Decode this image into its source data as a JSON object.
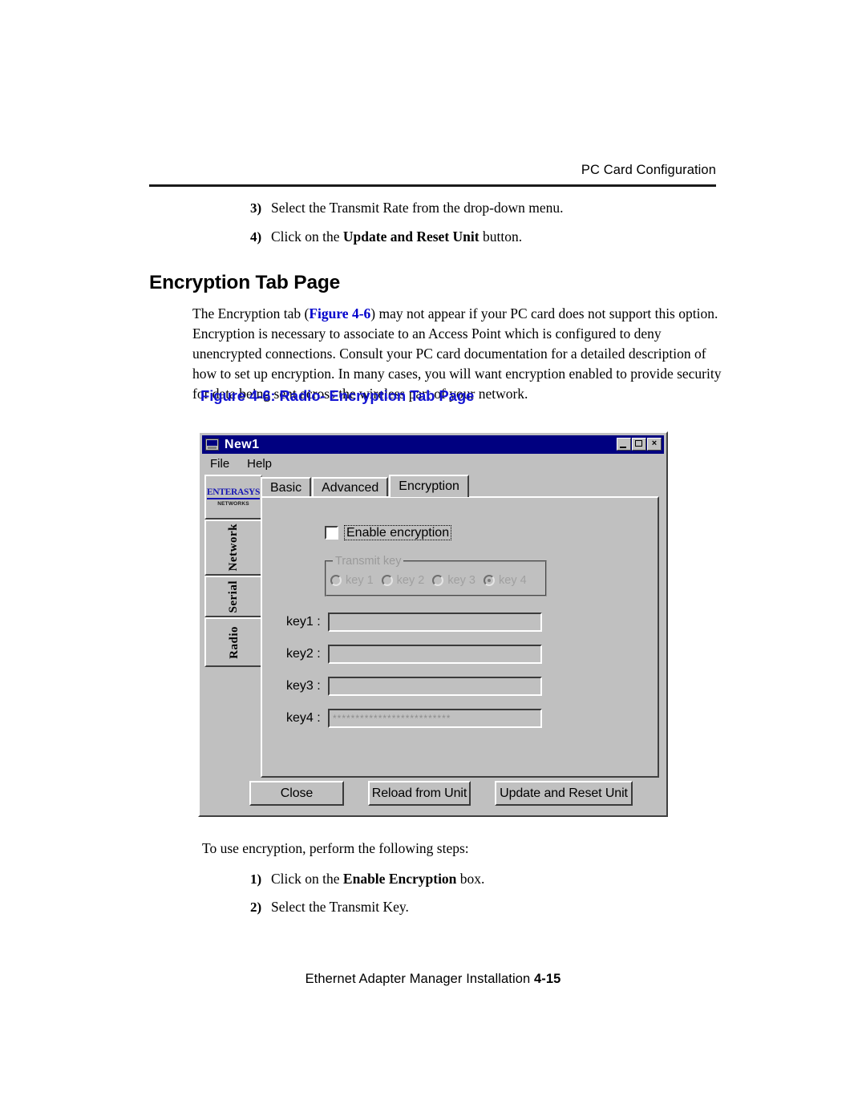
{
  "page": {
    "running_head": "PC Card Configuration",
    "section_heading": "Encryption Tab Page",
    "footer_text": "Ethernet Adapter Manager Installation",
    "footer_page": "4-15",
    "figure_caption": "Figure  4-6: Radio- Encryption Tab Page",
    "intro_line": "To use encryption, perform the following steps:"
  },
  "top_steps": [
    {
      "num": "3)",
      "text_before": "Select the Transmit Rate from the drop-down menu.",
      "bold": "",
      "text_after": ""
    },
    {
      "num": "4)",
      "text_before": "Click on the ",
      "bold": "Update and Reset Unit",
      "text_after": " button."
    }
  ],
  "paragraph": {
    "part1": "The Encryption tab (",
    "figref": "Figure 4-6",
    "part2": ") may not appear if your PC card does not support this option. Encryption is necessary to associate to an Access Point which is configured to deny unencrypted connections. Consult your PC card documentation for a detailed description of how to set up encryption. In many cases, you will want encryption enabled to provide security for data being sent across the wireless part of your network."
  },
  "bottom_steps": [
    {
      "num": "1)",
      "text_before": "Click on the ",
      "bold": "Enable Encryption",
      "text_after": " box."
    },
    {
      "num": "2)",
      "text_before": "Select the Transmit Key.",
      "bold": "",
      "text_after": ""
    }
  ],
  "dialog": {
    "title": "New1",
    "titlebar_color": "#000080",
    "face_color": "#c0c0c0",
    "window_buttons": {
      "minimize": "minimize-icon",
      "maximize": "maximize-icon",
      "close": "×"
    },
    "menu": [
      {
        "label": "File"
      },
      {
        "label": "Help"
      }
    ],
    "brand": {
      "name": "ENTERASYS",
      "sub": "NETWORKS",
      "color": "#1616b4"
    },
    "side_tabs": [
      {
        "label": "Network",
        "selected": false
      },
      {
        "label": "Serial",
        "selected": false
      },
      {
        "label": "Radio",
        "selected": true
      }
    ],
    "tabs": [
      {
        "label": "Basic",
        "selected": false
      },
      {
        "label": "Advanced",
        "selected": false
      },
      {
        "label": "Encryption",
        "selected": true
      }
    ],
    "enable_encryption": {
      "label": "Enable encryption",
      "checked": false
    },
    "transmit_key_group": {
      "title": "Transmit key",
      "disabled": true,
      "options": [
        {
          "label": "key 1",
          "selected": false
        },
        {
          "label": "key 2",
          "selected": false
        },
        {
          "label": "key 3",
          "selected": false
        },
        {
          "label": "key 4",
          "selected": true
        }
      ]
    },
    "key_fields": [
      {
        "label": "key1 :",
        "value": ""
      },
      {
        "label": "key2 :",
        "value": ""
      },
      {
        "label": "key3 :",
        "value": ""
      },
      {
        "label": "key4 :",
        "value": "**************************"
      }
    ],
    "buttons": [
      {
        "label": "Close",
        "name": "close-button"
      },
      {
        "label": "Reload from Unit",
        "name": "reload-from-unit-button"
      },
      {
        "label": "Update and Reset Unit",
        "name": "update-and-reset-unit-button"
      }
    ]
  }
}
